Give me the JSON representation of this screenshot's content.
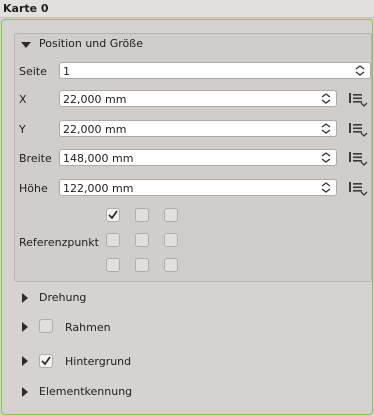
{
  "panel": {
    "title": "Karte 0"
  },
  "position_group": {
    "title": "Position und Größe",
    "page": {
      "label": "Seite",
      "value": "1"
    },
    "x": {
      "label": "X",
      "value": "22,000 mm"
    },
    "y": {
      "label": "Y",
      "value": "22,000 mm"
    },
    "width": {
      "label": "Breite",
      "value": "148,000 mm"
    },
    "height": {
      "label": "Höhe",
      "value": "122,000 mm"
    },
    "reference_point": {
      "label": "Referenzpunkt",
      "selected": "top-left"
    }
  },
  "sections": {
    "rotation": {
      "label": "Drehung"
    },
    "frame": {
      "label": "Rahmen",
      "checked": false
    },
    "background": {
      "label": "Hintergrund",
      "checked": true
    },
    "item_id": {
      "label": "Elementkennung"
    }
  }
}
